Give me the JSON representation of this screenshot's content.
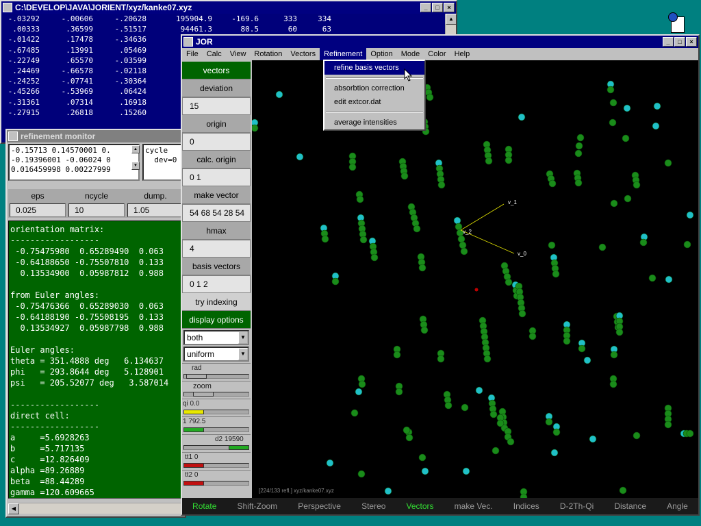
{
  "desktop": {
    "bg": "#008080"
  },
  "xyz_window": {
    "title": "C:\\DEVELOP\\JAVA\\JORIENT/xyz/kanke07.xyz",
    "rows": [
      [
        "-.03292",
        "-.00606",
        "-.20628",
        "195904.9",
        "-169.6",
        "333",
        "334"
      ],
      [
        ".00333",
        ".36599",
        "-.51517",
        "94461.3",
        "80.5",
        "60",
        "63"
      ],
      [
        "-.01422",
        ".17478",
        "-.34636",
        "",
        "",
        "",
        ""
      ],
      [
        "-.67485",
        ".13991",
        ".05469",
        "",
        "",
        "",
        ""
      ],
      [
        "-.22749",
        ".65570",
        "-.03599",
        "",
        "",
        "",
        ""
      ],
      [
        ".24469",
        "-.66578",
        "-.02118",
        "",
        "",
        "",
        ""
      ],
      [
        "-.24252",
        "-.07741",
        "-.30364",
        "",
        "",
        "",
        ""
      ],
      [
        "-.45266",
        "-.53969",
        ".06424",
        "",
        "",
        "",
        ""
      ],
      [
        "-.31361",
        ".07314",
        ".16918",
        "",
        "",
        "",
        ""
      ],
      [
        "-.27915",
        ".26818",
        ".15260",
        "",
        "",
        "",
        ""
      ]
    ]
  },
  "monitor": {
    "title": "refinement monitor",
    "list_left": "-0.15713 0.14570001 0.\n-0.19396001 -0.06024 0\n0.016459998 0.00227999",
    "list_right": "cycle\n  dev=0",
    "params": {
      "headers": [
        "eps",
        "ncycle",
        "dump."
      ],
      "values": [
        "0.025",
        "10",
        "1.05"
      ]
    },
    "output": "orientation matrix:\n------------------\n -0.75475980  0.65289490  0.063\n -0.64188650 -0.75507810  0.133\n  0.13534900  0.05987812  0.988\n\nfrom Euler angles:\n -0.75476366  0.65289030  0.063\n -0.64188190 -0.75508195  0.133\n  0.13534927  0.05987798  0.988\n\nEuler angles:\ntheta = 351.4888 deg   6.134637\nphi   = 293.8644 deg   5.128901\npsi   = 205.52077 deg   3.587014\n\n------------------\ndirect cell:\n------------------\na     =5.6928263\nb     =5.717135\nc     =12.826409\nalpha =89.26889\nbeta  =88.44289\ngamma =120.609665"
  },
  "jor": {
    "title": "JOR",
    "menu": [
      "File",
      "Calc",
      "View",
      "Rotation",
      "Vectors",
      "Refinement",
      "Option",
      "Mode",
      "Color",
      "Help"
    ],
    "active_menu": "Refinement",
    "dropdown": [
      "refine basis vectors",
      "absorbtion correction",
      "edit extcor.dat",
      "average intensities"
    ],
    "sidebar": {
      "vectors": "vectors",
      "deviation": "deviation",
      "deviation_val": "15",
      "origin": "origin",
      "origin_val": "0",
      "calc_origin": "calc. origin",
      "calc_origin_val": "0 1",
      "make_vector": "make vector",
      "make_vector_val": "54 68 54 28 54",
      "hmax": "hmax",
      "hmax_val": "4",
      "basis_vectors": "basis vectors",
      "basis_vectors_val": "0 1 2",
      "try_indexing": "try indexing",
      "display_options": "display options",
      "select1": "both",
      "select2": "uniform",
      "rad": "rad",
      "zoom": "zoom",
      "qi": "qi 0.0",
      "s1": "1  792.5",
      "d2": "d2 19590",
      "tt1": "tt1 0",
      "tt2": "tt2 0"
    },
    "status": "[224/133 refl.] xyz/kanke07.xyz",
    "vector_labels": [
      "v_1",
      "v_2",
      "v_0"
    ],
    "bottom": [
      {
        "label": "Rotate",
        "on": true
      },
      {
        "label": "Shift-Zoom",
        "on": false
      },
      {
        "label": "Perspective",
        "on": false
      },
      {
        "label": "Stereo",
        "on": false
      },
      {
        "label": "Vectors",
        "on": true
      },
      {
        "label": "make Vec.",
        "on": false
      },
      {
        "label": "Indices",
        "on": false
      },
      {
        "label": "D-2Th-Qi",
        "on": false
      },
      {
        "label": "Distance",
        "on": false
      },
      {
        "label": "Angle",
        "on": false
      }
    ],
    "colors": {
      "green_dot": "#1a8c1a",
      "cyan_dot": "#20c0c8",
      "yellow": "#e0e000",
      "red": "#c00000"
    }
  }
}
